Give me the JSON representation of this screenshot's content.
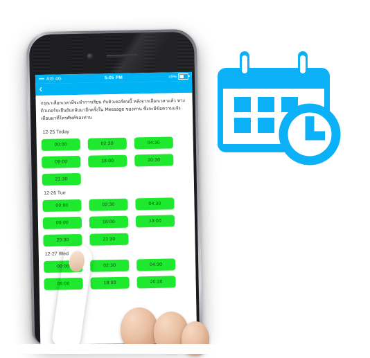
{
  "scene": {
    "background_color": "#ffffff",
    "description_label": "mobile-booking-screen-with-hand"
  },
  "icon": {
    "name": "calendar-clock-icon",
    "color": "#00a8f3",
    "accent": "#0bb0f6"
  },
  "phone": {
    "frame_color": "#75787f",
    "camera_label": "front-camera",
    "speaker_label": "earpiece-speaker"
  },
  "statusbar": {
    "signal_dots": "••••",
    "carrier": "AIS 4G",
    "time": "5:05 PM",
    "battery_percent": "49%",
    "battery_level": 49,
    "background_color": "#00b3f4"
  },
  "navbar": {
    "back_icon": "‹",
    "background_color": "#00b3f4"
  },
  "content": {
    "intro_text": "กรุณาเลือกเวลาที่จะทำการเรียน กับติวเตอร์คนนี้ หลังจากเลือกเวลาแล้ว ทางติวเตอร์จะยืนยันกลับมาอีกครั้งใน Message ของท่าน ซึ่งจะมีข้อความแจ้งเตือนมาที่โทรศัพท์ของท่าน",
    "slot_color": "#1fe92f",
    "days": [
      {
        "label": "12-25 Today",
        "rows": [
          [
            "00:00",
            "02:30",
            "04:30"
          ],
          [
            "09:00",
            "18:00",
            "20:30"
          ],
          [
            "21:30"
          ]
        ]
      },
      {
        "label": "12-26 Tue",
        "rows": [
          [
            "00:00",
            "02:30",
            "04:30"
          ],
          [
            "09:00",
            "18:00",
            "19:00"
          ],
          [
            "20:30",
            "21:30"
          ]
        ]
      },
      {
        "label": "12-27 Wed",
        "rows": [
          [
            "00:00",
            "02:30",
            "04:30"
          ],
          [
            "09:00",
            "18:00",
            "20:30"
          ]
        ]
      }
    ]
  }
}
